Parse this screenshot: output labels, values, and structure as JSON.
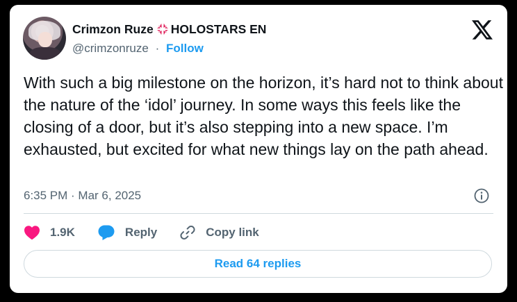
{
  "author": {
    "display_name": "Crimzon Ruze",
    "name_suffix": "HOLOSTARS EN",
    "handle": "@crimzonruze",
    "separator": "·",
    "follow_label": "Follow",
    "badge_icon": "anger-symbol-icon",
    "badge_color": "#e0245e"
  },
  "tweet": {
    "text": "With such a big milestone on the horizon, it’s hard not to think about the nature of the ‘idol’ journey.  In some ways this feels like the closing of a door, but it’s also stepping into a new space.  I’m exhausted, but excited for what new things lay on the path ahead.",
    "timestamp": "6:35 PM · Mar 6, 2025"
  },
  "actions": {
    "likes": "1.9K",
    "reply_label": "Reply",
    "copy_label": "Copy link",
    "like_color": "#f91880",
    "reply_color": "#1d9bf0"
  },
  "footer": {
    "read_replies_label": "Read 64 replies"
  },
  "icons": {
    "platform_logo": "x-logo-icon",
    "info": "info-icon"
  }
}
